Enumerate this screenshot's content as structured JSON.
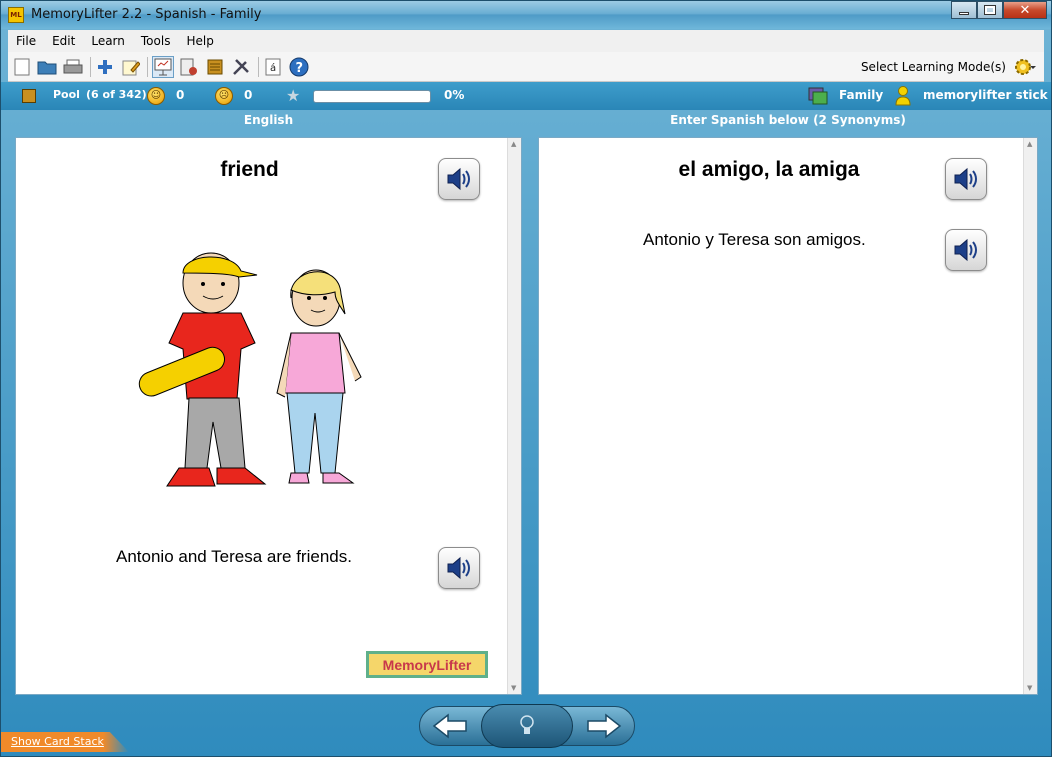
{
  "window": {
    "title": "MemoryLifter 2.2 - Spanish - Family",
    "app_icon_text": "ML"
  },
  "menu": [
    "File",
    "Edit",
    "Learn",
    "Tools",
    "Help"
  ],
  "toolbar": {
    "mode_label": "Select Learning Mode(s)"
  },
  "status": {
    "pool_label": "Pool",
    "pool_count": "(6 of 342)",
    "correct": "0",
    "wrong": "0",
    "progress_text": "0%",
    "progress": 0,
    "dictionary": "Family",
    "user": "memorylifter stick"
  },
  "question": {
    "header": "English",
    "word": "friend",
    "sentence": "Antonio and Teresa are friends."
  },
  "answer": {
    "header": "Enter Spanish below (2 Synonyms)",
    "word": "el amigo, la amiga",
    "sentence": "Antonio y Teresa son amigos."
  },
  "logo": "MemoryLifter",
  "footer": {
    "show_stack": "Show Card Stack"
  },
  "colors": {
    "accent": "#2f8bbd",
    "panel": "#ffffff",
    "stack_tab": "#f08a2a"
  }
}
